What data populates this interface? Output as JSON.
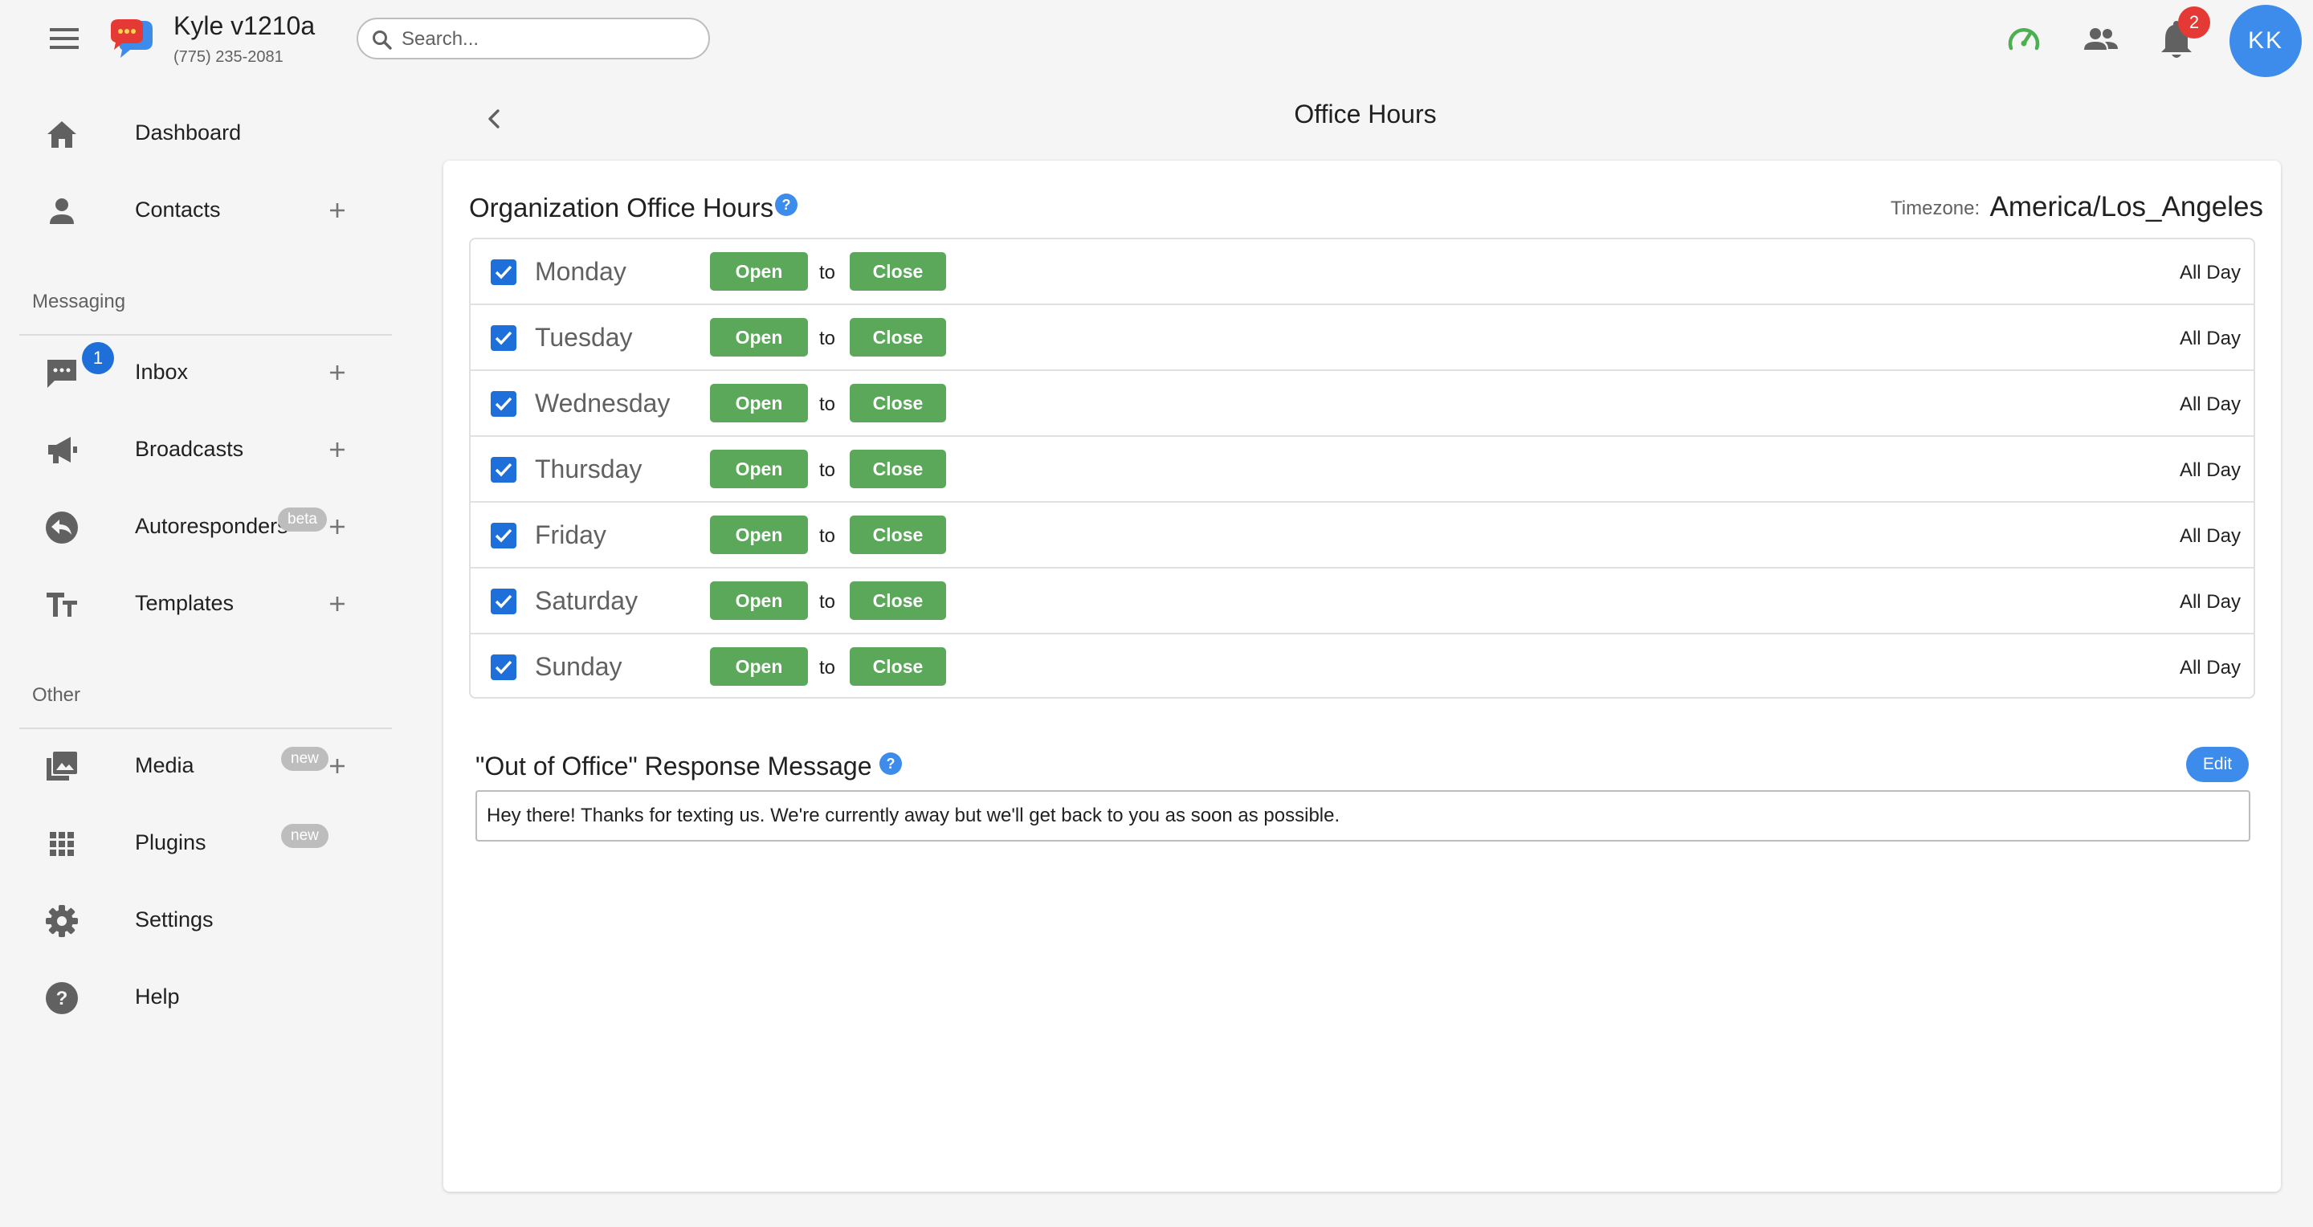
{
  "header": {
    "org_name": "Kyle v1210a",
    "org_phone": "(775) 235-2081",
    "search_placeholder": "Search...",
    "notification_count": "2",
    "avatar_initials": "KK",
    "speed_icon_color": "#4caf50"
  },
  "sidebar": {
    "items_top": [
      {
        "label": "Dashboard",
        "icon": "home-icon"
      },
      {
        "label": "Contacts",
        "icon": "person-icon"
      }
    ],
    "messaging_label": "Messaging",
    "messaging": [
      {
        "label": "Inbox",
        "icon": "chat-icon",
        "badge": "1"
      },
      {
        "label": "Broadcasts",
        "icon": "megaphone-icon"
      },
      {
        "label": "Autoresponders",
        "icon": "reply-icon",
        "chip": "beta"
      },
      {
        "label": "Templates",
        "icon": "text-format-icon"
      }
    ],
    "other_label": "Other",
    "other": [
      {
        "label": "Media",
        "icon": "photo-library-icon",
        "chip": "new"
      },
      {
        "label": "Plugins",
        "icon": "apps-grid-icon",
        "chip": "new"
      },
      {
        "label": "Settings",
        "icon": "gear-icon"
      },
      {
        "label": "Help",
        "icon": "help-circle-icon"
      }
    ]
  },
  "main": {
    "page_title": "Office Hours",
    "office_hours": {
      "heading": "Organization Office Hours",
      "timezone_label": "Timezone:",
      "timezone_value": "America/Los_Angeles",
      "open_label": "Open",
      "to_label": "to",
      "close_label": "Close",
      "days": [
        {
          "name": "Monday",
          "checked": true,
          "status": "All Day"
        },
        {
          "name": "Tuesday",
          "checked": true,
          "status": "All Day"
        },
        {
          "name": "Wednesday",
          "checked": true,
          "status": "All Day"
        },
        {
          "name": "Thursday",
          "checked": true,
          "status": "All Day"
        },
        {
          "name": "Friday",
          "checked": true,
          "status": "All Day"
        },
        {
          "name": "Saturday",
          "checked": true,
          "status": "All Day"
        },
        {
          "name": "Sunday",
          "checked": true,
          "status": "All Day"
        }
      ]
    },
    "out_of_office": {
      "heading": "\"Out of Office\" Response Message",
      "edit_label": "Edit",
      "message": "Hey there! Thanks for texting us. We're currently away but we'll get back to you as soon as possible."
    }
  },
  "colors": {
    "accent_blue": "#3d8bea",
    "open_close_green": "#5ba85b",
    "checkbox_blue": "#1e6fd9",
    "badge_red": "#e53935"
  }
}
